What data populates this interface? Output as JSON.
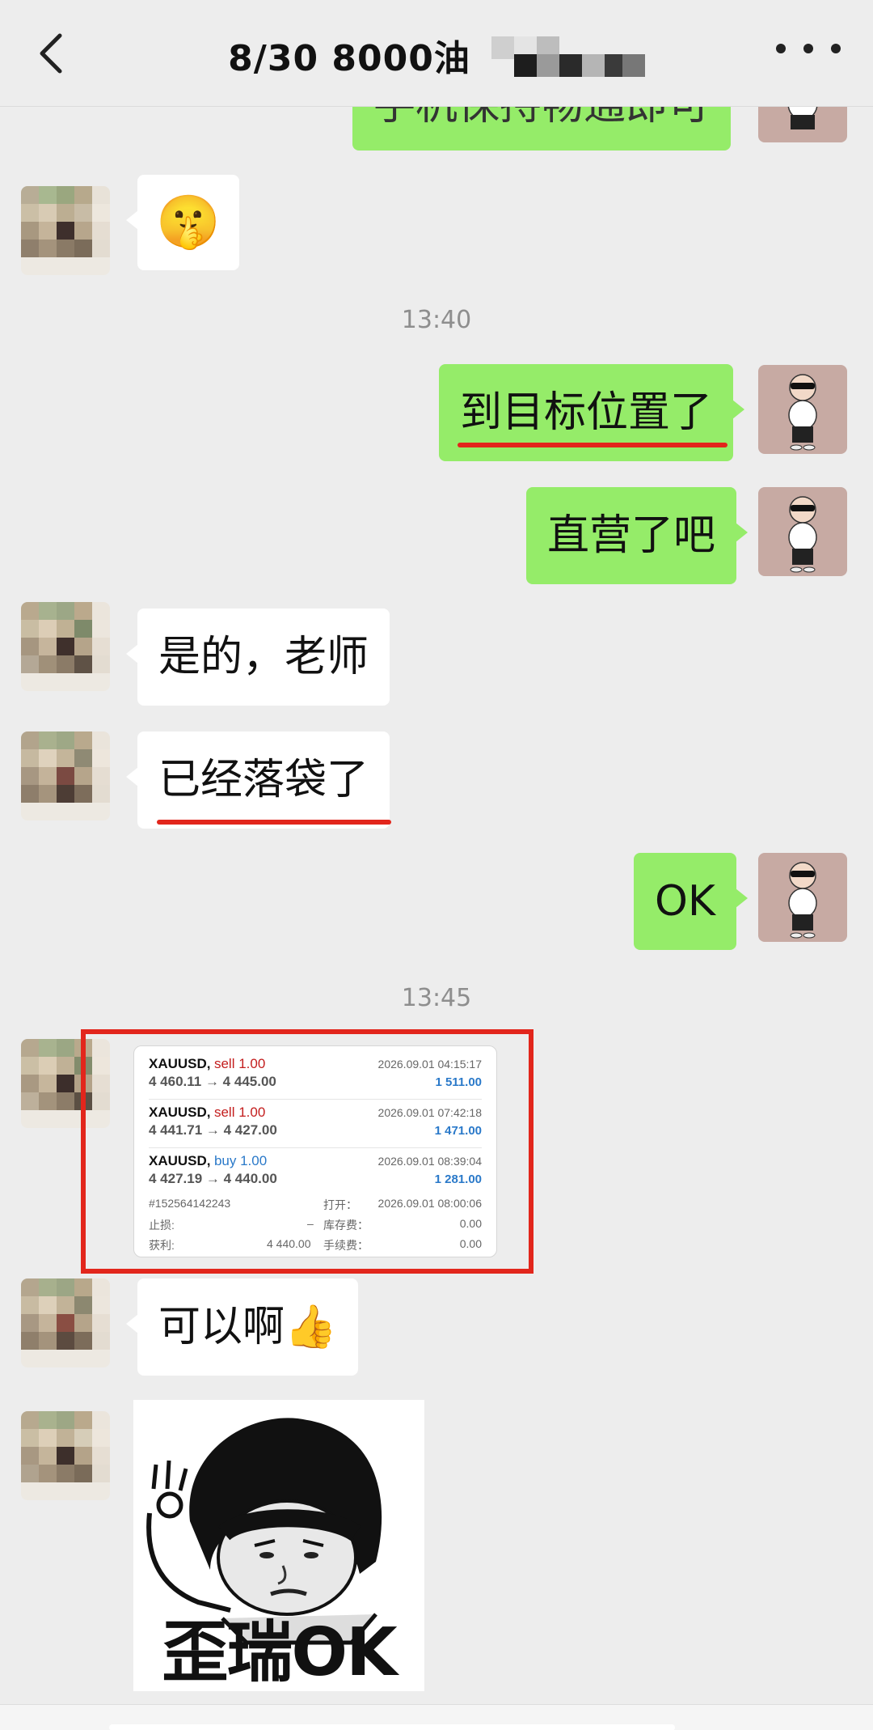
{
  "header": {
    "title": "8/30  8000油",
    "back_icon": "chevron-left-icon",
    "more_icon": "more-dots-icon"
  },
  "messages": {
    "prev_partial": "手机保持畅通即可",
    "m1_emoji": "🤫",
    "time_1": "13:40",
    "m2": "到目标位置了",
    "m3": "直营了吧",
    "m4": "是的，老师",
    "m5": "已经落袋了",
    "m6": "OK",
    "time_2": "13:45",
    "m8": "可以啊👍",
    "sticker_caption": "歪瑞OK"
  },
  "trade_card": {
    "trades": [
      {
        "symbol": "XAUUSD,",
        "side": "sell 1.00",
        "prices": "4 460.11 → 4 445.00",
        "date": "2026.09.01 04:15:17",
        "profit": "1 511.00"
      },
      {
        "symbol": "XAUUSD,",
        "side": "sell 1.00",
        "prices": "4 441.71 → 4 427.00",
        "date": "2026.09.01 07:42:18",
        "profit": "1 471.00"
      },
      {
        "symbol": "XAUUSD,",
        "side": "buy 1.00",
        "prices": "4 427.19 → 4 440.00",
        "date": "2026.09.01 08:39:04",
        "profit": "1 281.00"
      }
    ],
    "order_id": "#152564142243",
    "open_label": "打开：",
    "open_time": "2026.09.01 08:00:06",
    "sl_label": "止损:",
    "sl_value": "–",
    "swap_label": "库存费：",
    "swap_value": "0.00",
    "tp_label": "获利:",
    "tp_value": "4 440.00",
    "fee_label": "手续费：",
    "fee_value": "0.00"
  },
  "colors": {
    "bg": "#ededed",
    "my_bubble": "#95ec69",
    "their_bubble": "#ffffff",
    "highlight": "#e2261c",
    "sell": "#c31d1d",
    "buy": "#2a79c9"
  }
}
